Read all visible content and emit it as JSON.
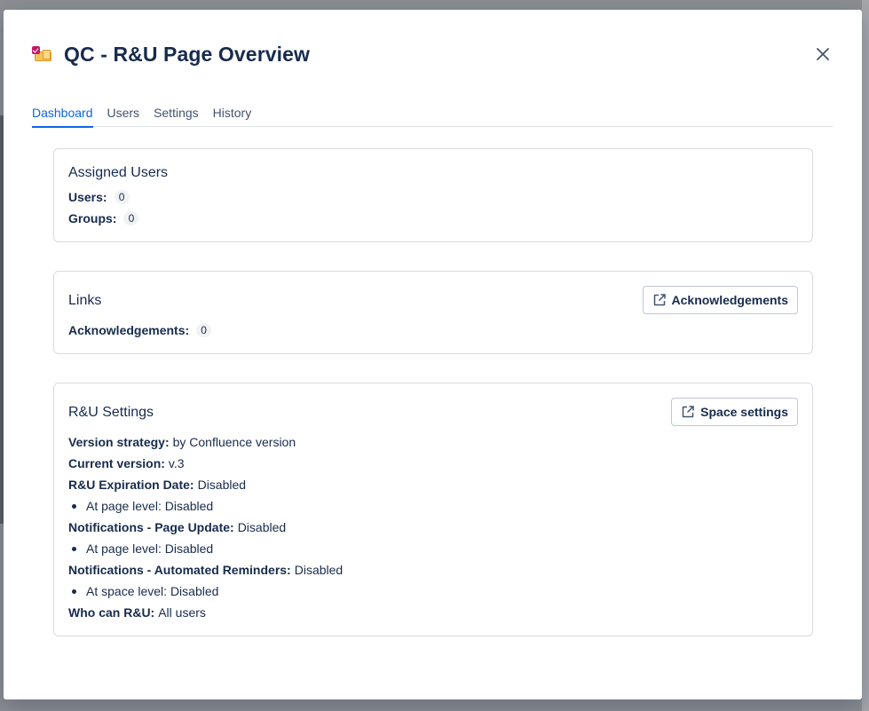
{
  "modal": {
    "title": "QC - R&U Page Overview"
  },
  "tabs": [
    "Dashboard",
    "Users",
    "Settings",
    "History"
  ],
  "assigned_users": {
    "title": "Assigned Users",
    "users_label": "Users:",
    "users_count": "0",
    "groups_label": "Groups:",
    "groups_count": "0"
  },
  "links": {
    "title": "Links",
    "ack_label": "Acknowledgements:",
    "ack_count": "0",
    "ack_button": "Acknowledgements"
  },
  "ru_settings": {
    "title": "R&U Settings",
    "space_settings_button": "Space settings",
    "version_strategy_label": "Version strategy:",
    "version_strategy_value": "by Confluence version",
    "current_version_label": "Current version:",
    "current_version_value": "v.3",
    "expiration_label": "R&U Expiration Date:",
    "expiration_value": "Disabled",
    "expiration_sub": "At page level: Disabled",
    "page_update_label": "Notifications - Page Update:",
    "page_update_value": "Disabled",
    "page_update_sub": "At page level: Disabled",
    "reminders_label": "Notifications - Automated Reminders:",
    "reminders_value": "Disabled",
    "reminders_sub": "At space level: Disabled",
    "who_label": "Who can R&U:",
    "who_value": "All users"
  },
  "colors": {
    "accent": "#0c66e4",
    "text": "#172b4d",
    "badge_bg": "#f1f2f4",
    "border": "#d9dbe0"
  }
}
